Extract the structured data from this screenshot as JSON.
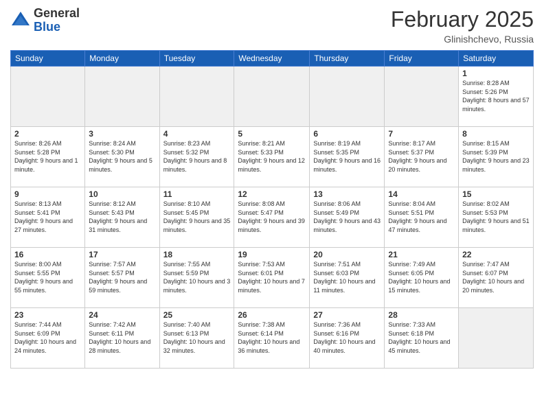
{
  "header": {
    "logo": {
      "line1": "General",
      "line2": "Blue"
    },
    "title": "February 2025",
    "location": "Glinishchevo, Russia"
  },
  "weekdays": [
    "Sunday",
    "Monday",
    "Tuesday",
    "Wednesday",
    "Thursday",
    "Friday",
    "Saturday"
  ],
  "weeks": [
    [
      {
        "day": "",
        "info": ""
      },
      {
        "day": "",
        "info": ""
      },
      {
        "day": "",
        "info": ""
      },
      {
        "day": "",
        "info": ""
      },
      {
        "day": "",
        "info": ""
      },
      {
        "day": "",
        "info": ""
      },
      {
        "day": "1",
        "info": "Sunrise: 8:28 AM\nSunset: 5:26 PM\nDaylight: 8 hours and 57 minutes."
      }
    ],
    [
      {
        "day": "2",
        "info": "Sunrise: 8:26 AM\nSunset: 5:28 PM\nDaylight: 9 hours and 1 minute."
      },
      {
        "day": "3",
        "info": "Sunrise: 8:24 AM\nSunset: 5:30 PM\nDaylight: 9 hours and 5 minutes."
      },
      {
        "day": "4",
        "info": "Sunrise: 8:23 AM\nSunset: 5:32 PM\nDaylight: 9 hours and 8 minutes."
      },
      {
        "day": "5",
        "info": "Sunrise: 8:21 AM\nSunset: 5:33 PM\nDaylight: 9 hours and 12 minutes."
      },
      {
        "day": "6",
        "info": "Sunrise: 8:19 AM\nSunset: 5:35 PM\nDaylight: 9 hours and 16 minutes."
      },
      {
        "day": "7",
        "info": "Sunrise: 8:17 AM\nSunset: 5:37 PM\nDaylight: 9 hours and 20 minutes."
      },
      {
        "day": "8",
        "info": "Sunrise: 8:15 AM\nSunset: 5:39 PM\nDaylight: 9 hours and 23 minutes."
      }
    ],
    [
      {
        "day": "9",
        "info": "Sunrise: 8:13 AM\nSunset: 5:41 PM\nDaylight: 9 hours and 27 minutes."
      },
      {
        "day": "10",
        "info": "Sunrise: 8:12 AM\nSunset: 5:43 PM\nDaylight: 9 hours and 31 minutes."
      },
      {
        "day": "11",
        "info": "Sunrise: 8:10 AM\nSunset: 5:45 PM\nDaylight: 9 hours and 35 minutes."
      },
      {
        "day": "12",
        "info": "Sunrise: 8:08 AM\nSunset: 5:47 PM\nDaylight: 9 hours and 39 minutes."
      },
      {
        "day": "13",
        "info": "Sunrise: 8:06 AM\nSunset: 5:49 PM\nDaylight: 9 hours and 43 minutes."
      },
      {
        "day": "14",
        "info": "Sunrise: 8:04 AM\nSunset: 5:51 PM\nDaylight: 9 hours and 47 minutes."
      },
      {
        "day": "15",
        "info": "Sunrise: 8:02 AM\nSunset: 5:53 PM\nDaylight: 9 hours and 51 minutes."
      }
    ],
    [
      {
        "day": "16",
        "info": "Sunrise: 8:00 AM\nSunset: 5:55 PM\nDaylight: 9 hours and 55 minutes."
      },
      {
        "day": "17",
        "info": "Sunrise: 7:57 AM\nSunset: 5:57 PM\nDaylight: 9 hours and 59 minutes."
      },
      {
        "day": "18",
        "info": "Sunrise: 7:55 AM\nSunset: 5:59 PM\nDaylight: 10 hours and 3 minutes."
      },
      {
        "day": "19",
        "info": "Sunrise: 7:53 AM\nSunset: 6:01 PM\nDaylight: 10 hours and 7 minutes."
      },
      {
        "day": "20",
        "info": "Sunrise: 7:51 AM\nSunset: 6:03 PM\nDaylight: 10 hours and 11 minutes."
      },
      {
        "day": "21",
        "info": "Sunrise: 7:49 AM\nSunset: 6:05 PM\nDaylight: 10 hours and 15 minutes."
      },
      {
        "day": "22",
        "info": "Sunrise: 7:47 AM\nSunset: 6:07 PM\nDaylight: 10 hours and 20 minutes."
      }
    ],
    [
      {
        "day": "23",
        "info": "Sunrise: 7:44 AM\nSunset: 6:09 PM\nDaylight: 10 hours and 24 minutes."
      },
      {
        "day": "24",
        "info": "Sunrise: 7:42 AM\nSunset: 6:11 PM\nDaylight: 10 hours and 28 minutes."
      },
      {
        "day": "25",
        "info": "Sunrise: 7:40 AM\nSunset: 6:13 PM\nDaylight: 10 hours and 32 minutes."
      },
      {
        "day": "26",
        "info": "Sunrise: 7:38 AM\nSunset: 6:14 PM\nDaylight: 10 hours and 36 minutes."
      },
      {
        "day": "27",
        "info": "Sunrise: 7:36 AM\nSunset: 6:16 PM\nDaylight: 10 hours and 40 minutes."
      },
      {
        "day": "28",
        "info": "Sunrise: 7:33 AM\nSunset: 6:18 PM\nDaylight: 10 hours and 45 minutes."
      },
      {
        "day": "",
        "info": ""
      }
    ]
  ]
}
